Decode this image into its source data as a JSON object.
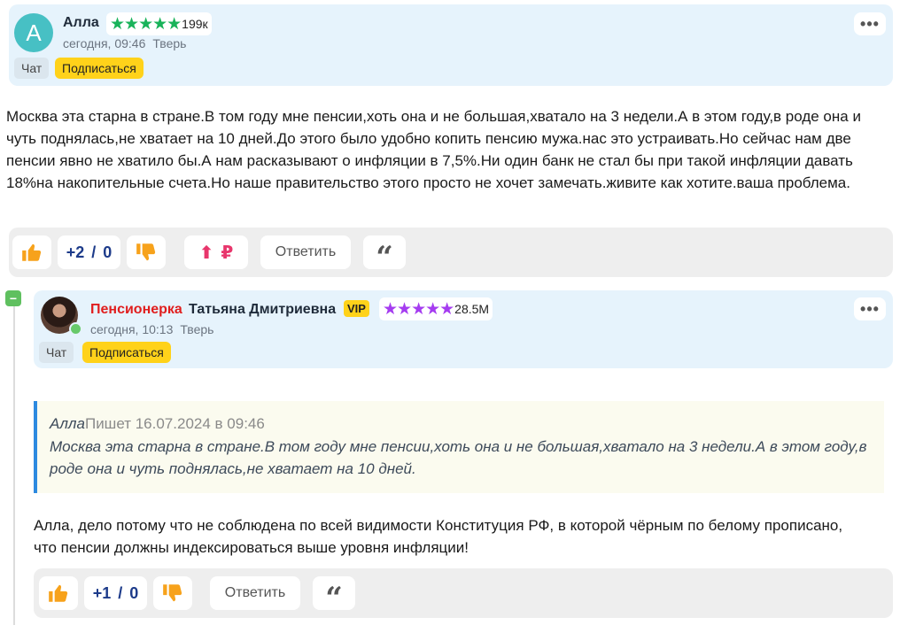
{
  "comment1": {
    "avatar_letter": "А",
    "author": "Алла",
    "stars": "★★★★★",
    "rating_count": "199к",
    "time": "сегодня, 09:46",
    "city": "Тверь",
    "chat_label": "Чат",
    "subscribe_label": "Подписаться",
    "more": "•••",
    "text": "Москва эта старна в стране.В том году мне пенсии,хоть она и не большая,хватало на 3 недели.А в этом году,в роде она и чуть поднялась,не хватает на 10 дней.До этого было удобно копить пенсию мужа.нас это устраивать.Но сейчас нам две пенсии явно не хватило бы.А нам расказывают о инфляции в 7,5%.Ни один банк не стал бы при такой инфляции давать 18%на накопительные счета.Но наше правительство этого просто не хочет замечать.живите как хотите.ваша проблема.",
    "score_plus": "+2",
    "score_sep": "/",
    "score_minus": "0",
    "boost_arrow": "⬆",
    "boost_currency": "₽",
    "reply_label": "Ответить",
    "quote_label": "“"
  },
  "comment2": {
    "collapse": "−",
    "rank": "Пенсионерка",
    "author": "Татьяна Дмитриевна",
    "vip": "VIP",
    "stars": "★★★★★",
    "rating_count": "28.5M",
    "time": "сегодня, 10:13",
    "city": "Тверь",
    "chat_label": "Чат",
    "subscribe_label": "Подписаться",
    "more": "•••",
    "quote": {
      "author": "Алла",
      "wrote": "Пишет 16.07.2024 в 09:46",
      "text": "Москва эта старна в стране.В том году мне пенсии,хоть она и не большая,хватало на 3 недели.А в этом году,в роде она и чуть поднялась,не хватает на 10 дней."
    },
    "text": "Алла, дело потому что не соблюдена по всей видимости Конституция РФ, в которой чёрным по белому прописано, что пенсии должны индексироваться выше уровня инфляции!",
    "score_plus": "+1",
    "score_sep": "/",
    "score_minus": "0",
    "reply_label": "Ответить",
    "quote_label": "“"
  },
  "colors": {
    "green_stars": "#19b35a",
    "purple_stars": "#a53cf0",
    "rank_red": "#e01e1e",
    "like_orange": "#f7a21b",
    "boost_pink": "#e8366c",
    "score_blue": "#1d3b8a",
    "card_bg": "#e6f3fc",
    "subscribe_yellow": "#ffd21a",
    "quote_border": "#2d8ae0"
  }
}
